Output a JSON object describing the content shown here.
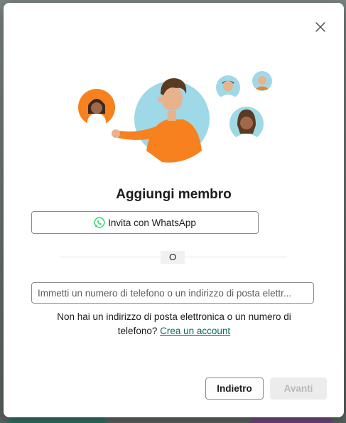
{
  "dialog": {
    "title": "Aggiungi membro",
    "whatsapp_button_label": "Invita con WhatsApp",
    "separator_label": "O",
    "contact_input": {
      "value": "",
      "placeholder": "Immetti un numero di telefono o un indirizzo di posta elettr..."
    },
    "hint_text": "Non hai un indirizzo di posta elettronica o un numero di telefono?",
    "create_account_link": "Crea un account",
    "back_button_label": "Indietro",
    "next_button_label": "Avanti"
  },
  "colors": {
    "accent_orange": "#f7811e",
    "avatar_blue": "#9fd8e6",
    "whatsapp_green": "#25d366",
    "link_green": "#006e5f",
    "disabled_button_bg": "#ececec"
  },
  "icons": {
    "close": "close-icon",
    "whatsapp": "whatsapp-icon"
  }
}
